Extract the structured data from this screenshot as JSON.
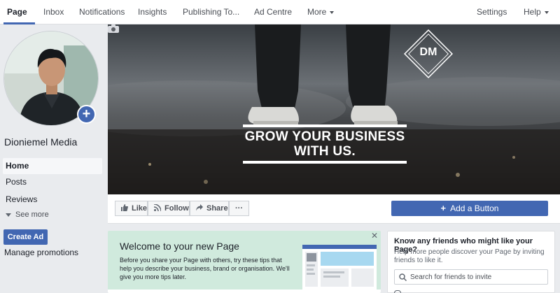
{
  "topnav": {
    "items": [
      "Page",
      "Inbox",
      "Notifications",
      "Insights",
      "Publishing To...",
      "Ad Centre",
      "More"
    ],
    "settings": "Settings",
    "help": "Help"
  },
  "sidebar": {
    "page_name": "Dioniemel Media",
    "items": [
      "Home",
      "Posts",
      "Reviews"
    ],
    "see_more": "See more",
    "create_ad": "Create Ad",
    "manage_promotions": "Manage promotions"
  },
  "cover": {
    "logo": "DM",
    "headline_line1": "GROW YOUR BUSINESS",
    "headline_line2": "WITH US."
  },
  "actions": {
    "like": "Like",
    "follow": "Follow",
    "share": "Share",
    "more": "···",
    "add_button": "Add a Button"
  },
  "welcome": {
    "title": "Welcome to your new Page",
    "text": "Before you share your Page with others, try these tips that help you describe your business, brand or organisation. We'll give you more tips later.",
    "close": "✕"
  },
  "friends": {
    "title": "Know any friends who might like your Page?",
    "text": "Help more people discover your Page by inviting friends to like it.",
    "search_placeholder": "Search for friends to invite"
  },
  "colors": {
    "brand_blue": "#4267b2",
    "nav_bg": "#ffffff",
    "page_bg": "#e9ebee",
    "welcome_bg": "#d0eadd"
  }
}
